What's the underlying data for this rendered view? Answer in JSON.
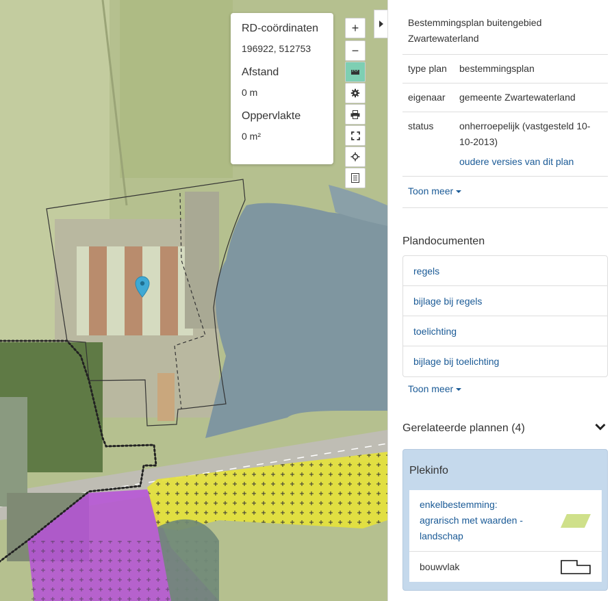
{
  "map": {
    "measure": {
      "coord_label": "RD-coördinaten",
      "coord_value": "196922, 512753",
      "distance_label": "Afstand",
      "distance_value": "0 m",
      "area_label": "Oppervlakte",
      "area_value": "0 m²"
    },
    "tools": [
      {
        "name": "zoom-in",
        "icon": "plus-icon",
        "glyph": "+"
      },
      {
        "name": "zoom-out",
        "icon": "minus-icon",
        "glyph": "−"
      },
      {
        "name": "measure",
        "icon": "ruler-icon",
        "active": true
      },
      {
        "name": "settings",
        "icon": "gear-icon"
      },
      {
        "name": "print",
        "icon": "printer-icon"
      },
      {
        "name": "fullscreen",
        "icon": "expand-icon"
      },
      {
        "name": "locate",
        "icon": "crosshair-icon"
      },
      {
        "name": "legend",
        "icon": "list-icon"
      }
    ],
    "collapse_icon": "chevron-right-icon",
    "colors": {
      "water": "#7f96a0",
      "meadow": "#b7c291",
      "agrarisch": "#cfe08a",
      "bedrijf": "#b651d8",
      "gemengd": "#e6e23a",
      "road": "#bfbdb4",
      "marker": "#3fa9d4"
    }
  },
  "panel": {
    "plan_title": "Bestemmingsplan buitengebied Zwartewaterland",
    "info": [
      {
        "key": "type plan",
        "value": "bestemmingsplan"
      },
      {
        "key": "eigenaar",
        "value": "gemeente Zwartewaterland"
      },
      {
        "key": "status",
        "value": "onherroepelijk (vastgesteld 10-10-2013)",
        "link": "oudere versies van dit plan"
      }
    ],
    "toon_meer_1": "Toon meer",
    "documents_heading": "Plandocumenten",
    "documents": [
      "regels",
      "bijlage bij regels",
      "toelichting",
      "bijlage bij toelichting"
    ],
    "toon_meer_2": "Toon meer",
    "related_heading": "Gerelateerde plannen (4)",
    "plekinfo": {
      "heading": "Plekinfo",
      "items": [
        {
          "label": "enkelbestemming: agrarisch met waarden - landschap",
          "link": true,
          "swatch_color": "#cfe08a"
        },
        {
          "label": "bouwvlak",
          "link": false
        }
      ]
    }
  }
}
